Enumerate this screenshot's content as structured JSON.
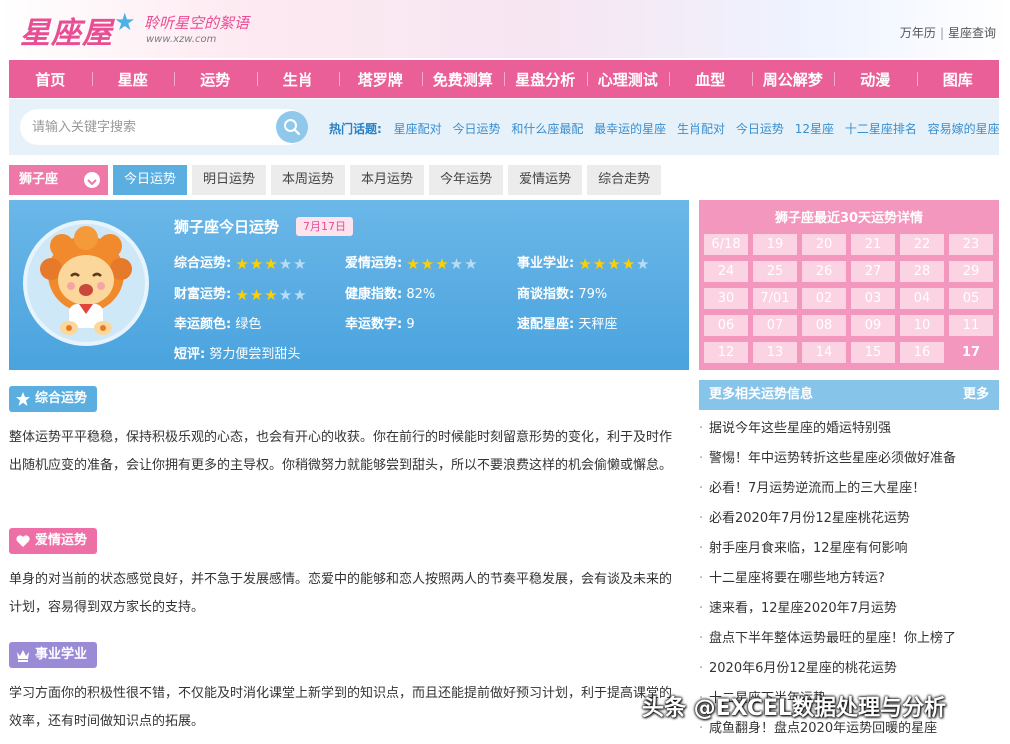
{
  "header": {
    "logo_text": "星座屋",
    "slogan": "聆听星空的絮语",
    "url": "www.xzw.com",
    "top_links": [
      "万年历",
      "星座查询"
    ],
    "top_sep": "|"
  },
  "nav": [
    "首页",
    "星座",
    "运势",
    "生肖",
    "塔罗牌",
    "免费测算",
    "星盘分析",
    "心理测试",
    "血型",
    "周公解梦",
    "动漫",
    "图库"
  ],
  "search": {
    "placeholder": "请输入关键字搜索",
    "hot_label": "热门话题:",
    "hot_topics": [
      "星座配对",
      "今日运势",
      "和什么座最配",
      "最幸运的星座",
      "生肖配对",
      "今日运势",
      "12星座",
      "十二星座排名",
      "容易嫁的星座"
    ]
  },
  "tabs": {
    "sign": "狮子座",
    "items": [
      "今日运势",
      "明日运势",
      "本周运势",
      "本月运势",
      "今年运势",
      "爱情运势",
      "综合走势"
    ],
    "active_index": 0
  },
  "card": {
    "title": "狮子座今日运势",
    "date": "7月17日",
    "rows": {
      "overall": {
        "label": "综合运势:",
        "stars": 3,
        "max": 5
      },
      "love": {
        "label": "爱情运势:",
        "stars": 3,
        "max": 5
      },
      "career": {
        "label": "事业学业:",
        "stars": 4,
        "max": 5
      },
      "wealth": {
        "label": "财富运势:",
        "stars": 3,
        "max": 5
      },
      "health": {
        "label": "健康指数:",
        "value": "82%"
      },
      "negotiation": {
        "label": "商谈指数:",
        "value": "79%"
      },
      "color": {
        "label": "幸运颜色:",
        "value": "绿色"
      },
      "number": {
        "label": "幸运数字:",
        "value": "9"
      },
      "match": {
        "label": "速配星座:",
        "value": "天秤座"
      },
      "comment": {
        "label": "短评:",
        "value": "努力便尝到甜头"
      }
    },
    "colors": {
      "star_on": "#ffd000",
      "star_off": "#b8dcf4"
    }
  },
  "calendar": {
    "title": "狮子座最近30天运势详情",
    "days": [
      "6/18",
      "19",
      "20",
      "21",
      "22",
      "23",
      "24",
      "25",
      "26",
      "27",
      "28",
      "29",
      "30",
      "7/01",
      "02",
      "03",
      "04",
      "05",
      "06",
      "07",
      "08",
      "09",
      "10",
      "11",
      "12",
      "13",
      "14",
      "15",
      "16",
      "17"
    ],
    "today": "17"
  },
  "sections": {
    "overall": {
      "title": "综合运势",
      "text": "整体运势平平稳稳，保持积极乐观的心态，也会有开心的收获。你在前行的时候能时刻留意形势的变化，利于及时作出随机应变的准备，会让你拥有更多的主导权。你稍微努力就能够尝到甜头，所以不要浪费这样的机会偷懒或懈怠。"
    },
    "love": {
      "title": "爱情运势",
      "text": "单身的对当前的状态感觉良好，并不急于发展感情。恋爱中的能够和恋人按照两人的节奏平稳发展，会有谈及未来的计划，容易得到双方家长的支持。"
    },
    "career": {
      "title": "事业学业",
      "text": "学习方面你的积极性很不错，不仅能及时消化课堂上新学到的知识点，而且还能提前做好预习计划，利于提高课堂的效率，还有时间做知识点的拓展。"
    }
  },
  "more": {
    "title": "更多相关运势信息",
    "more_label": "更多",
    "items": [
      "据说今年这些星座的婚运特别强",
      "警惕！年中运势转折这些星座必须做好准备",
      "必看！7月运势逆流而上的三大星座！",
      "必看2020年7月份12星座桃花运势",
      "射手座月食来临，12星座有何影响",
      "十二星座将要在哪些地方转运?",
      "速来看，12星座2020年7月运势",
      "盘点下半年整体运势最旺的星座！你上榜了",
      "2020年6月份12星座的桃花运势",
      "十二星座下半年运势",
      "咸鱼翻身！盘点2020年运势回暖的星座"
    ]
  },
  "watermark": "头条 @EXCEL数据处理与分析",
  "colors": {
    "pink": "#ea5f97",
    "blue": "#4aa3de",
    "purple": "#9b8bd6"
  }
}
